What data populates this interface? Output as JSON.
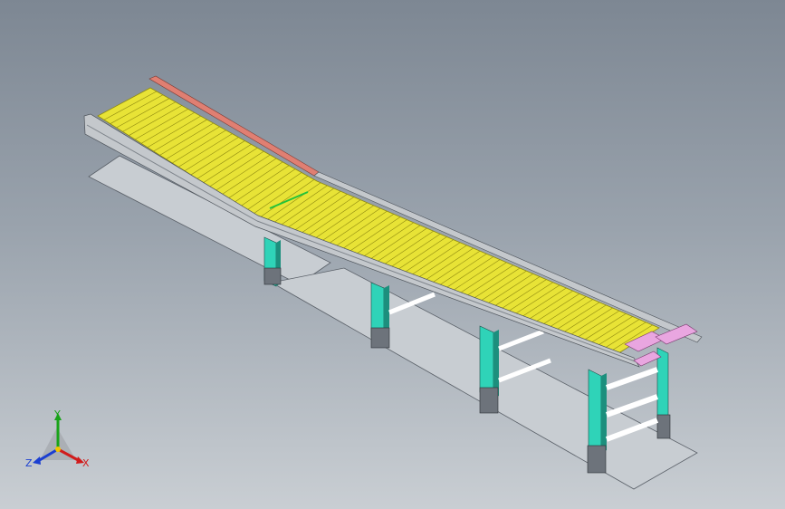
{
  "model": {
    "conveyor": {
      "roller_color": "#e8e336",
      "roller_edge_color": "#8f8a10",
      "rail_color": "#c4c8cc",
      "rail_dark": "#7d838a",
      "leg_color": "#2fd3b8",
      "leg_dark": "#1c8f7d",
      "guard_color": "#e07f72",
      "end_roller_color": "#e9a6e0",
      "floor_color": "#c5cad0"
    }
  },
  "triad": {
    "x_label": "X",
    "y_label": "Y",
    "z_label": "Z",
    "x_color": "#d11b1b",
    "y_color": "#19a319",
    "z_color": "#1b3fd1"
  }
}
